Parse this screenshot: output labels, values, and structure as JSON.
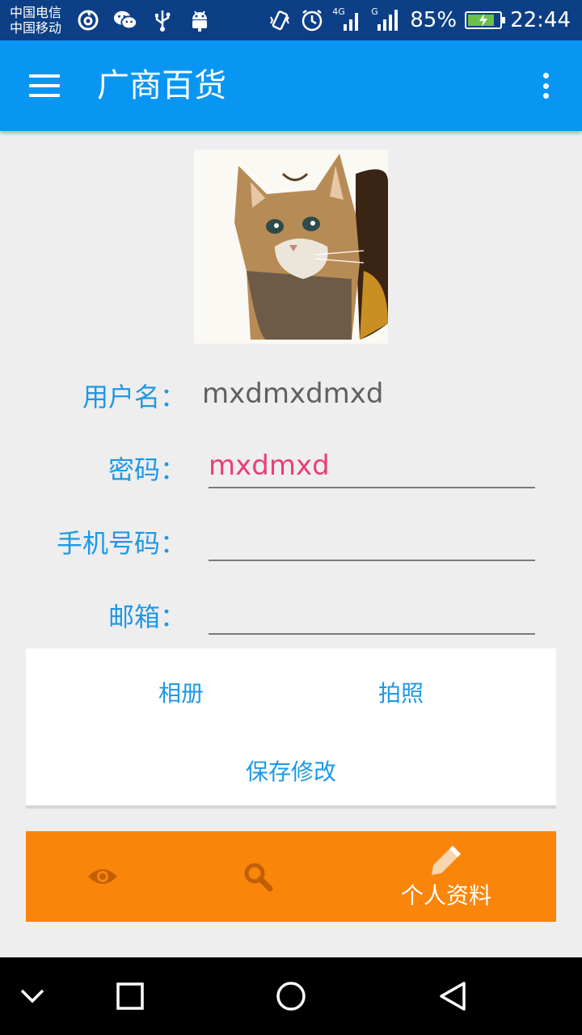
{
  "status_bar": {
    "carrier_1": "中国电信",
    "carrier_2": "中国移动",
    "network_1": "4G",
    "network_2": "G",
    "battery_percent": "85%",
    "battery_level": 0.85,
    "time": "22:44",
    "icons": [
      "netease-music-icon",
      "wechat-icon",
      "usb-icon",
      "android-icon",
      "vibrate-icon",
      "alarm-icon"
    ]
  },
  "app_bar": {
    "title": "广商百货"
  },
  "profile": {
    "username_label": "用户名：",
    "username_value": "mxdmxdmxd",
    "password_label": "密码：",
    "password_value": "mxdmxd",
    "phone_label": "手机号码：",
    "phone_value": "",
    "email_label": "邮箱：",
    "email_value": ""
  },
  "actions": {
    "album": "相册",
    "camera": "拍照",
    "save": "保存修改"
  },
  "tabs": {
    "profile_label": "个人资料"
  },
  "colors": {
    "status_bar": "#0d3f86",
    "app_bar": "#0996f3",
    "label_blue": "#1e98e6",
    "password_pink": "#e83f77",
    "tab_orange": "#fa850b",
    "inactive_icon": "#c25f05"
  }
}
